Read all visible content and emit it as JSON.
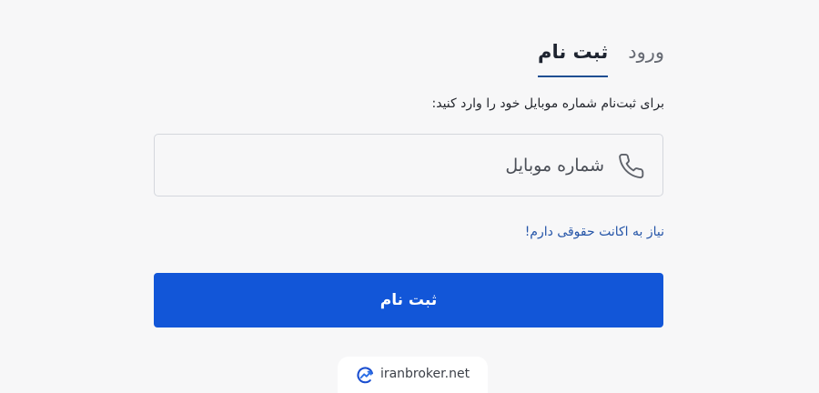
{
  "tabs": [
    {
      "label": "ثبت نام",
      "active": true
    },
    {
      "label": "ورود",
      "active": false
    }
  ],
  "instruction": "برای ثبت‌نام شماره موبایل خود را وارد کنید:",
  "phone_field": {
    "placeholder": "شماره موبایل",
    "value": "",
    "icon": "phone-icon"
  },
  "legal_link": "نیاز به اکانت حقوقی دارم!",
  "submit_button": "ثبت نام",
  "brand": {
    "name": "iranbroker.net",
    "icon": "iranbroker-logo-icon"
  },
  "colors": {
    "primary": "#1256d8",
    "link": "#2555a8",
    "tab_underline": "#1f4f92",
    "background": "#f7f7f8"
  }
}
